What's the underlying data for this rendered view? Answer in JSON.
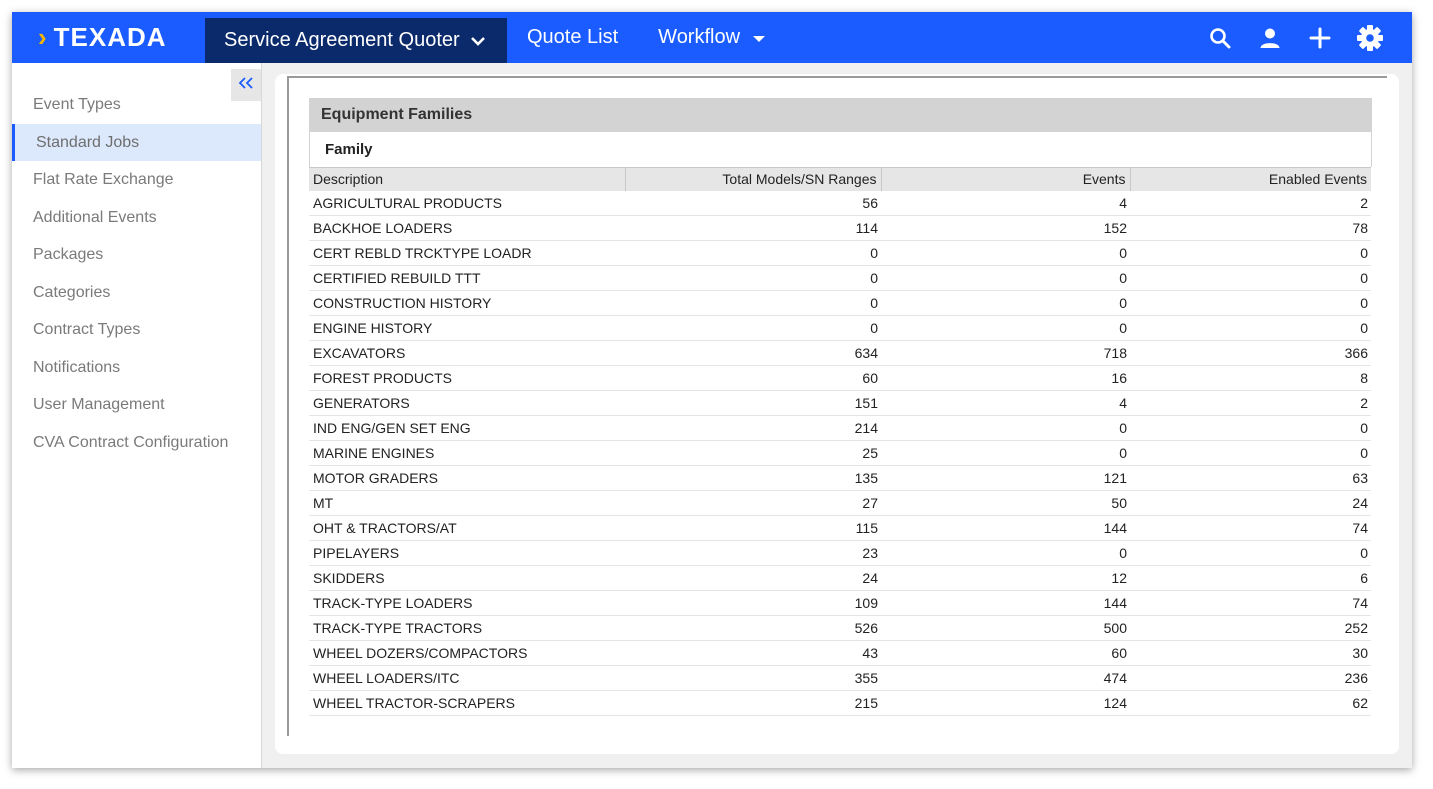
{
  "brand": {
    "logo_text": "TEXADA"
  },
  "topbar": {
    "app_selector": "Service Agreement Quoter",
    "quote_list": "Quote List",
    "workflow": "Workflow",
    "icons": [
      "search-icon",
      "user-icon",
      "plus-icon",
      "gear-icon"
    ]
  },
  "sidebar": {
    "items": [
      {
        "label": "Event Types"
      },
      {
        "label": "Standard Jobs",
        "active": true
      },
      {
        "label": "Flat Rate Exchange"
      },
      {
        "label": "Additional Events"
      },
      {
        "label": "Packages"
      },
      {
        "label": "Categories"
      },
      {
        "label": "Contract Types"
      },
      {
        "label": "Notifications"
      },
      {
        "label": "User Management"
      },
      {
        "label": "CVA Contract Configuration"
      }
    ]
  },
  "panel": {
    "title": "Equipment Families",
    "subtitle": "Family",
    "columns": [
      "Description",
      "Total Models/SN Ranges",
      "Events",
      "Enabled Events"
    ],
    "rows": [
      [
        "AGRICULTURAL PRODUCTS",
        "56",
        "4",
        "2"
      ],
      [
        "BACKHOE LOADERS",
        "114",
        "152",
        "78"
      ],
      [
        "CERT REBLD TRCKTYPE LOADR",
        "0",
        "0",
        "0"
      ],
      [
        "CERTIFIED REBUILD TTT",
        "0",
        "0",
        "0"
      ],
      [
        "CONSTRUCTION HISTORY",
        "0",
        "0",
        "0"
      ],
      [
        "ENGINE HISTORY",
        "0",
        "0",
        "0"
      ],
      [
        "EXCAVATORS",
        "634",
        "718",
        "366"
      ],
      [
        "FOREST PRODUCTS",
        "60",
        "16",
        "8"
      ],
      [
        "GENERATORS",
        "151",
        "4",
        "2"
      ],
      [
        "IND ENG/GEN SET ENG",
        "214",
        "0",
        "0"
      ],
      [
        "MARINE ENGINES",
        "25",
        "0",
        "0"
      ],
      [
        "MOTOR GRADERS",
        "135",
        "121",
        "63"
      ],
      [
        "MT",
        "27",
        "50",
        "24"
      ],
      [
        "OHT & TRACTORS/AT",
        "115",
        "144",
        "74"
      ],
      [
        "PIPELAYERS",
        "23",
        "0",
        "0"
      ],
      [
        "SKIDDERS",
        "24",
        "12",
        "6"
      ],
      [
        "TRACK-TYPE LOADERS",
        "109",
        "144",
        "74"
      ],
      [
        "TRACK-TYPE TRACTORS",
        "526",
        "500",
        "252"
      ],
      [
        "WHEEL DOZERS/COMPACTORS",
        "43",
        "60",
        "30"
      ],
      [
        "WHEEL LOADERS/ITC",
        "355",
        "474",
        "236"
      ],
      [
        "WHEEL TRACTOR-SCRAPERS",
        "215",
        "124",
        "62"
      ]
    ]
  },
  "colors": {
    "brand_blue": "#1a5cff",
    "active_nav": "#0b2a6b",
    "logo_accent": "#f7b500"
  }
}
